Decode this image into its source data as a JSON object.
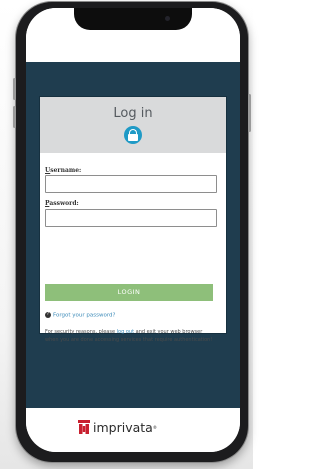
{
  "login": {
    "title": "Log in",
    "username_label_first": "U",
    "username_label_rest": "sername:",
    "password_label_first": "P",
    "password_label_rest": "assword:",
    "username_value": "",
    "password_value": "",
    "login_button": "LOGIN",
    "forgot_link": "Forgot your password?",
    "notice_prefix": "For security reasons, please ",
    "notice_link": "log out",
    "notice_suffix": " and exit your web browser when you are done accessing services that require authentication!"
  },
  "brand": {
    "name": "imprivata",
    "trademark": "®"
  },
  "colors": {
    "dark_background": "#1f3d4f",
    "header_gray": "#d9dadb",
    "accent_blue": "#1f9ac6",
    "button_green": "#8ebf7a",
    "link_blue": "#3b8ab8",
    "brand_red": "#c8202f"
  },
  "icons": {
    "lock": "lock-icon",
    "help": "question-circle-icon",
    "brand": "imprivata-logo"
  }
}
